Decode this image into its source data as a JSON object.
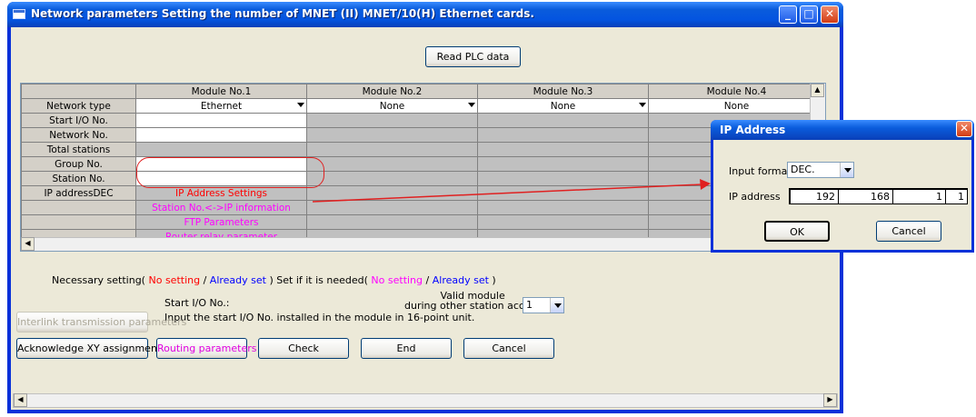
{
  "window": {
    "title": "Network parameters  Setting the number of MNET (II) MNET/10(H) Ethernet cards.",
    "minimize": "_",
    "maximize": "□",
    "close": "✕"
  },
  "read_plc_label": "Read PLC data",
  "grid": {
    "headers": [
      "",
      "Module No.1",
      "Module No.2",
      "Module No.3",
      "Module No.4"
    ],
    "row_labels": [
      "Network type",
      "Start I/O No.",
      "Network No.",
      "Total stations",
      "Group No.",
      "Station No.",
      "IP addressDEC",
      "",
      "",
      ""
    ],
    "network_types": [
      "Ethernet",
      "None",
      "None",
      "None"
    ],
    "module1_links": [
      "IP Address Settings",
      "Station No.<->IP information",
      "FTP Parameters",
      "Router relay parameter"
    ]
  },
  "legend": {
    "necessary_prefix": "Necessary setting(",
    "no_setting_1": "No setting",
    "slash_1": "/",
    "already_set_1": "Already set",
    "mid": ")    Set if it is needed(",
    "no_setting_2": "No setting",
    "slash_2": "/",
    "already_set_2": "Already set",
    "close": ")",
    "colors": {
      "no_setting": "#ff0000",
      "already_set": "#0000ff",
      "needed_no_setting": "#ff00ff"
    }
  },
  "start_io": {
    "label": "Start I/O No.:",
    "hint": "Input the start I/O No. installed in the module in 16-point unit."
  },
  "valid_module": {
    "label_line1": "Valid module",
    "label_line2": "during other station access",
    "value": "1"
  },
  "buttons": {
    "interlink": "Interlink transmission parameters",
    "acknowledge": "Acknowledge XY assignment",
    "routing": "Routing parameters",
    "check": "Check",
    "end": "End",
    "cancel": "Cancel"
  },
  "ip_dialog": {
    "title": "IP Address",
    "close": "✕",
    "input_format_label": "Input format",
    "input_format_value": "DEC.",
    "ip_label": "IP address",
    "octets": [
      "192",
      "168",
      "1",
      "1"
    ],
    "ok": "OK",
    "cancel": "Cancel"
  },
  "icons": [
    "window-icon",
    "dropdown-arrow-icon",
    "scroll-up-icon",
    "scroll-left-icon",
    "scroll-right-icon",
    "red-arrow-icon"
  ]
}
